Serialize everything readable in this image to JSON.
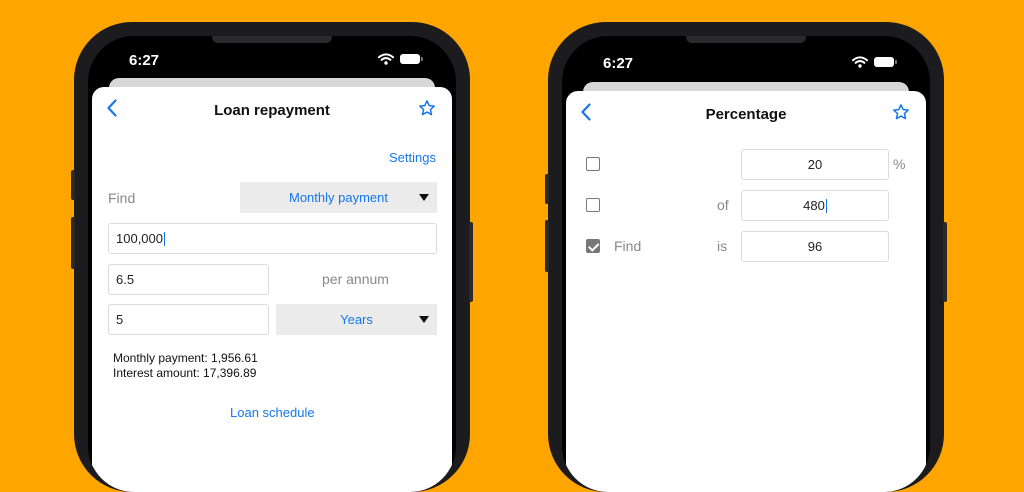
{
  "colors": {
    "background": "#FFA500",
    "accent": "#1577ea",
    "field_bg": "#ebebeb"
  },
  "left_phone": {
    "status": {
      "time": "6:27",
      "icons": [
        "wifi-icon",
        "battery-icon"
      ]
    },
    "nav": {
      "title": "Loan repayment",
      "back_icon": "chevron-left-icon",
      "star_icon": "star-icon"
    },
    "settings_label": "Settings",
    "find_label": "Find",
    "find_select": "Monthly payment",
    "amount": "100,000",
    "rate": "6.5",
    "rate_unit": "per annum",
    "term": "5",
    "term_select": "Years",
    "results": {
      "monthly_payment": "Monthly payment: 1,956.61",
      "interest_amount": "Interest amount: 17,396.89"
    },
    "schedule_link": "Loan schedule"
  },
  "right_phone": {
    "status": {
      "time": "6:27",
      "icons": [
        "wifi-icon",
        "battery-icon"
      ]
    },
    "nav": {
      "title": "Percentage",
      "back_icon": "chevron-left-icon",
      "star_icon": "star-icon"
    },
    "row1": {
      "checked": false,
      "value": "20",
      "suffix": "%"
    },
    "row2": {
      "checked": false,
      "label": "of",
      "value": "480"
    },
    "row3": {
      "checked": true,
      "find_label": "Find",
      "label": "is",
      "value": "96"
    }
  }
}
